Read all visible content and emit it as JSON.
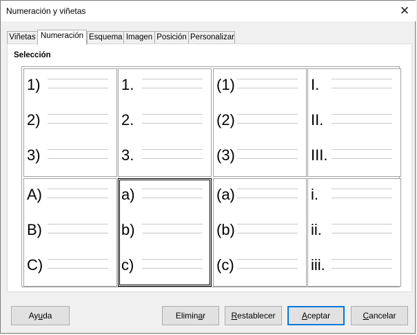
{
  "window": {
    "title": "Numeración y viñetas"
  },
  "tabs": [
    {
      "label": "Viñetas",
      "active": false
    },
    {
      "label": "Numeración",
      "active": true
    },
    {
      "label": "Esquema",
      "active": false
    },
    {
      "label": "Imagen",
      "active": false
    },
    {
      "label": "Posición",
      "active": false
    },
    {
      "label": "Personalizar",
      "active": false
    }
  ],
  "section": {
    "label": "Selección"
  },
  "presets": [
    [
      "1)",
      "2)",
      "3)"
    ],
    [
      "1.",
      "2.",
      "3."
    ],
    [
      "(1)",
      "(2)",
      "(3)"
    ],
    [
      "I.",
      "II.",
      "III."
    ],
    [
      "A)",
      "B)",
      "C)"
    ],
    [
      "a)",
      "b)",
      "c)"
    ],
    [
      "(a)",
      "(b)",
      "(c)"
    ],
    [
      "i.",
      "ii.",
      "iii."
    ]
  ],
  "selected_preset": 5,
  "buttons": {
    "help": {
      "pre": "Ay",
      "ul": "u",
      "post": "da"
    },
    "delete": {
      "pre": "Elimin",
      "ul": "a",
      "post": "r"
    },
    "reset": {
      "pre": "",
      "ul": "R",
      "post": "establecer"
    },
    "ok": {
      "pre": "",
      "ul": "A",
      "post": "ceptar"
    },
    "cancel": {
      "pre": "",
      "ul": "C",
      "post": "ancelar"
    }
  },
  "colors": {
    "focus_border": "#0078d7"
  }
}
